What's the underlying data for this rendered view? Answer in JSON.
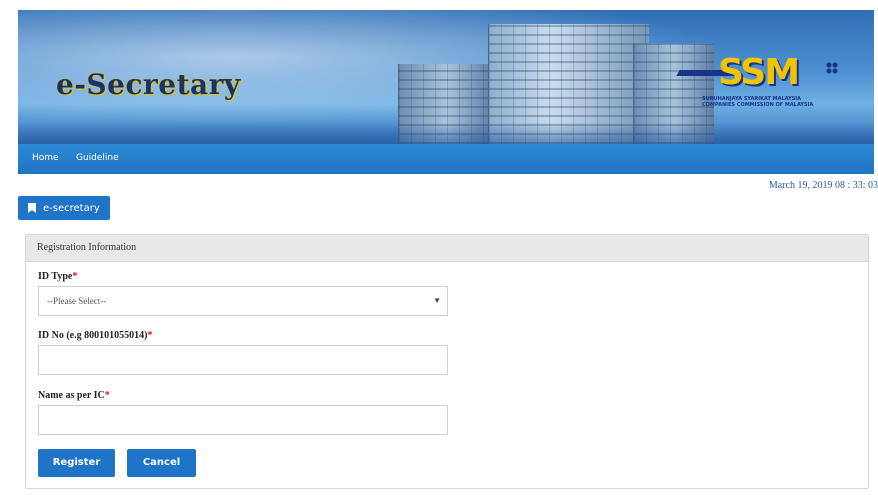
{
  "banner": {
    "app_name": "e-Secretary",
    "ssm_logo": "SSM",
    "ssm_caption": "SURUHANJAYA SYARIKAT MALAYSIA\nCOMPANIES COMMISSION OF MALAYSIA"
  },
  "nav": {
    "home": "Home",
    "guideline": "Guideline"
  },
  "datetime": "March 19, 2019 08 : 33: 03",
  "breadcrumb_chip": {
    "label": "e-secretary",
    "icon": "bookmark-icon"
  },
  "panel": {
    "title": "Registration Information",
    "id_type": {
      "label": "ID Type",
      "placeholder": "--Please Select--"
    },
    "id_no": {
      "label": "ID No (e.g 800101055014)",
      "value": ""
    },
    "name": {
      "label": "Name as per IC",
      "value": ""
    },
    "required_mark": "*"
  },
  "buttons": {
    "register": "Register",
    "cancel": "Cancel"
  },
  "colors": {
    "accent": "#1f74c8",
    "nav_bar": "#2680d0",
    "required": "#d11111"
  }
}
